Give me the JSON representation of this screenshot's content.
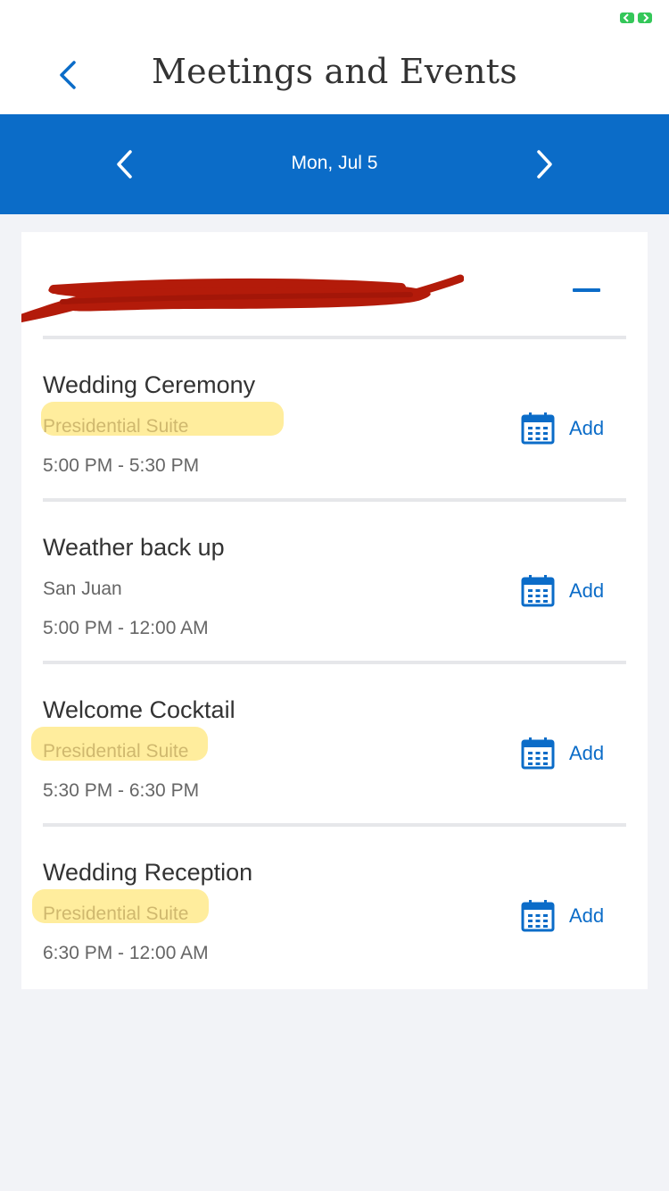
{
  "header": {
    "title": "Meetings and Events"
  },
  "date_nav": {
    "date": "Mon, Jul 5"
  },
  "events": [
    {
      "title": "Wedding Ceremony",
      "location": "Presidential Suite",
      "time": "5:00 PM - 5:30 PM",
      "add_label": "Add"
    },
    {
      "title": "Weather back up",
      "location": "San Juan",
      "time": "5:00 PM - 12:00 AM",
      "add_label": "Add"
    },
    {
      "title": "Welcome Cocktail",
      "location": "Presidential Suite",
      "time": "5:30 PM - 6:30 PM",
      "add_label": "Add"
    },
    {
      "title": "Wedding Reception",
      "location": "Presidential Suite",
      "time": "6:30 PM - 12:00 AM",
      "add_label": "Add"
    }
  ],
  "colors": {
    "accent": "#0b6cc8",
    "highlight": "#ffde4d",
    "redaction": "#b31b0a",
    "battery": "#34c759"
  },
  "icons": [
    "battery-icon",
    "back-chevron-icon",
    "chevron-left-icon",
    "chevron-right-icon",
    "minus-icon",
    "calendar-icon"
  ]
}
